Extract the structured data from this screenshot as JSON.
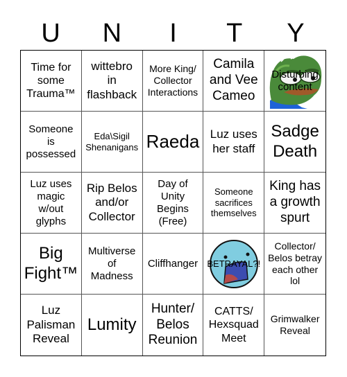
{
  "title_letters": [
    "U",
    "N",
    "I",
    "T",
    "Y"
  ],
  "cells": [
    {
      "text": "Time for\nsome\nTrauma™"
    },
    {
      "text": "wittebro\nin\nflashback"
    },
    {
      "text": "More King/\nCollector\nInteractions"
    },
    {
      "text": "Camila\nand Vee\nCameo"
    },
    {
      "text": "Disturbing\ncontent",
      "image": "pepe-frog-image"
    },
    {
      "text": "Someone\nis\npossessed"
    },
    {
      "text": "Eda\\Sigil\nShenanigans"
    },
    {
      "text": "Raeda"
    },
    {
      "text": "Luz uses\nher staff"
    },
    {
      "text": "Sadge\nDeath"
    },
    {
      "text": "Luz uses\nmagic\nw/out\nglyphs"
    },
    {
      "text": "Rip Belos\nand/or\nCollector"
    },
    {
      "text": "Day of\nUnity\nBegins\n(Free)"
    },
    {
      "text": "Someone\nsacrifices\nthemselves"
    },
    {
      "text": "King has\na growth\nspurt"
    },
    {
      "text": "Big\nFight™"
    },
    {
      "text": "Multiverse\nof\nMadness"
    },
    {
      "text": "Cliffhanger"
    },
    {
      "text": "BETRAYAL?!",
      "image": "shocked-face-image"
    },
    {
      "text": "Collector/\nBelos betray\neach other\nlol"
    },
    {
      "text": "Luz\nPalisman\nReveal"
    },
    {
      "text": "Lumity"
    },
    {
      "text": "Hunter/\nBelos\nReunion"
    },
    {
      "text": "CATTS/\nHexsquad\nMeet"
    },
    {
      "text": "Grimwalker\nReveal"
    }
  ]
}
